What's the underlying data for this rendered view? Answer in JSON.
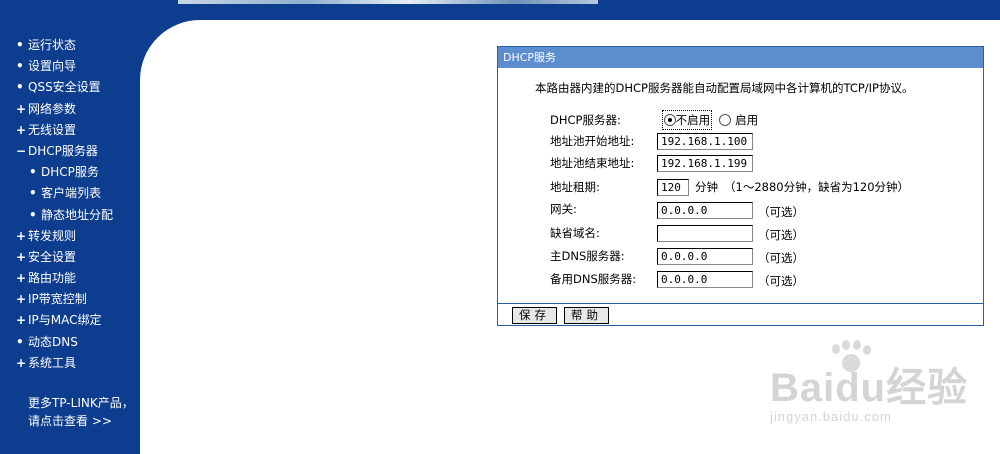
{
  "sidebar": {
    "items": [
      {
        "marker": "•",
        "label": "运行状态",
        "sub": false
      },
      {
        "marker": "•",
        "label": "设置向导",
        "sub": false
      },
      {
        "marker": "•",
        "label": "QSS安全设置",
        "sub": false
      },
      {
        "marker": "+",
        "label": "网络参数",
        "sub": false
      },
      {
        "marker": "+",
        "label": "无线设置",
        "sub": false
      },
      {
        "marker": "−",
        "label": "DHCP服务器",
        "sub": false
      },
      {
        "marker": "•",
        "label": "DHCP服务",
        "sub": true
      },
      {
        "marker": "•",
        "label": "客户端列表",
        "sub": true
      },
      {
        "marker": "•",
        "label": "静态地址分配",
        "sub": true
      },
      {
        "marker": "+",
        "label": "转发规则",
        "sub": false
      },
      {
        "marker": "+",
        "label": "安全设置",
        "sub": false
      },
      {
        "marker": "+",
        "label": "路由功能",
        "sub": false
      },
      {
        "marker": "+",
        "label": "IP带宽控制",
        "sub": false
      },
      {
        "marker": "+",
        "label": "IP与MAC绑定",
        "sub": false
      },
      {
        "marker": "•",
        "label": "动态DNS",
        "sub": false
      },
      {
        "marker": "+",
        "label": "系统工具",
        "sub": false
      }
    ],
    "more_line1": "更多TP-LINK产品，",
    "more_line2": "请点击查看 >>"
  },
  "panel": {
    "title": "DHCP服务",
    "description": "本路由器内建的DHCP服务器能自动配置局域网中各计算机的TCP/IP协议。",
    "dhcp_server_label": "DHCP服务器:",
    "option_disable": "不启用",
    "option_enable": "启用",
    "selected": "不启用",
    "start_label": "地址池开始地址:",
    "start_value": "192.168.1.100",
    "end_label": "地址池结束地址:",
    "end_value": "192.168.1.199",
    "lease_label": "地址租期:",
    "lease_value": "120",
    "lease_unit": "分钟",
    "lease_hint": "（1～2880分钟，缺省为120分钟）",
    "gateway_label": "网关:",
    "gateway_value": "0.0.0.0",
    "domain_label": "缺省域名:",
    "domain_value": "",
    "dns1_label": "主DNS服务器:",
    "dns1_value": "0.0.0.0",
    "dns2_label": "备用DNS服务器:",
    "dns2_value": "0.0.0.0",
    "optional": "（可选）",
    "save_button": "保存",
    "help_button": "帮助"
  },
  "watermark": {
    "brand": "Baidu经验",
    "url": "jingyan.baidu.com"
  }
}
